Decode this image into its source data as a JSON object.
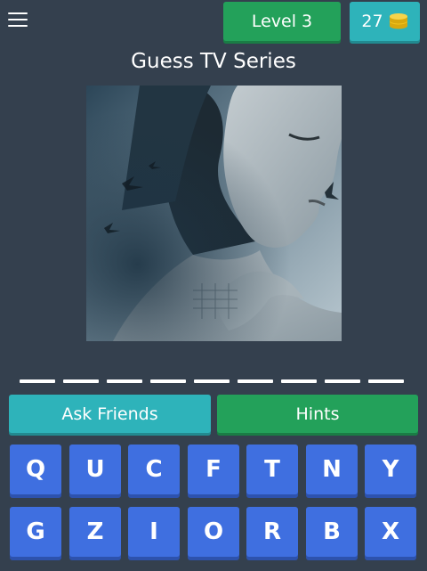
{
  "header": {
    "level_label": "Level 3",
    "coins": "27"
  },
  "title": "Guess TV Series",
  "answer_slots": 9,
  "actions": {
    "ask_friends": "Ask Friends",
    "hints": "Hints"
  },
  "keyboard": {
    "row1": [
      "Q",
      "U",
      "C",
      "F",
      "T",
      "N",
      "Y"
    ],
    "row2": [
      "G",
      "Z",
      "I",
      "O",
      "R",
      "B",
      "X"
    ]
  },
  "colors": {
    "background": "#34404e",
    "level_green": "#23a15a",
    "coin_teal": "#2eb3ba",
    "key_blue": "#3f6fe0",
    "coin_gold": "#f2c41d"
  },
  "icons": {
    "menu": "hamburger-menu-icon",
    "coins": "coin-stack-icon"
  }
}
